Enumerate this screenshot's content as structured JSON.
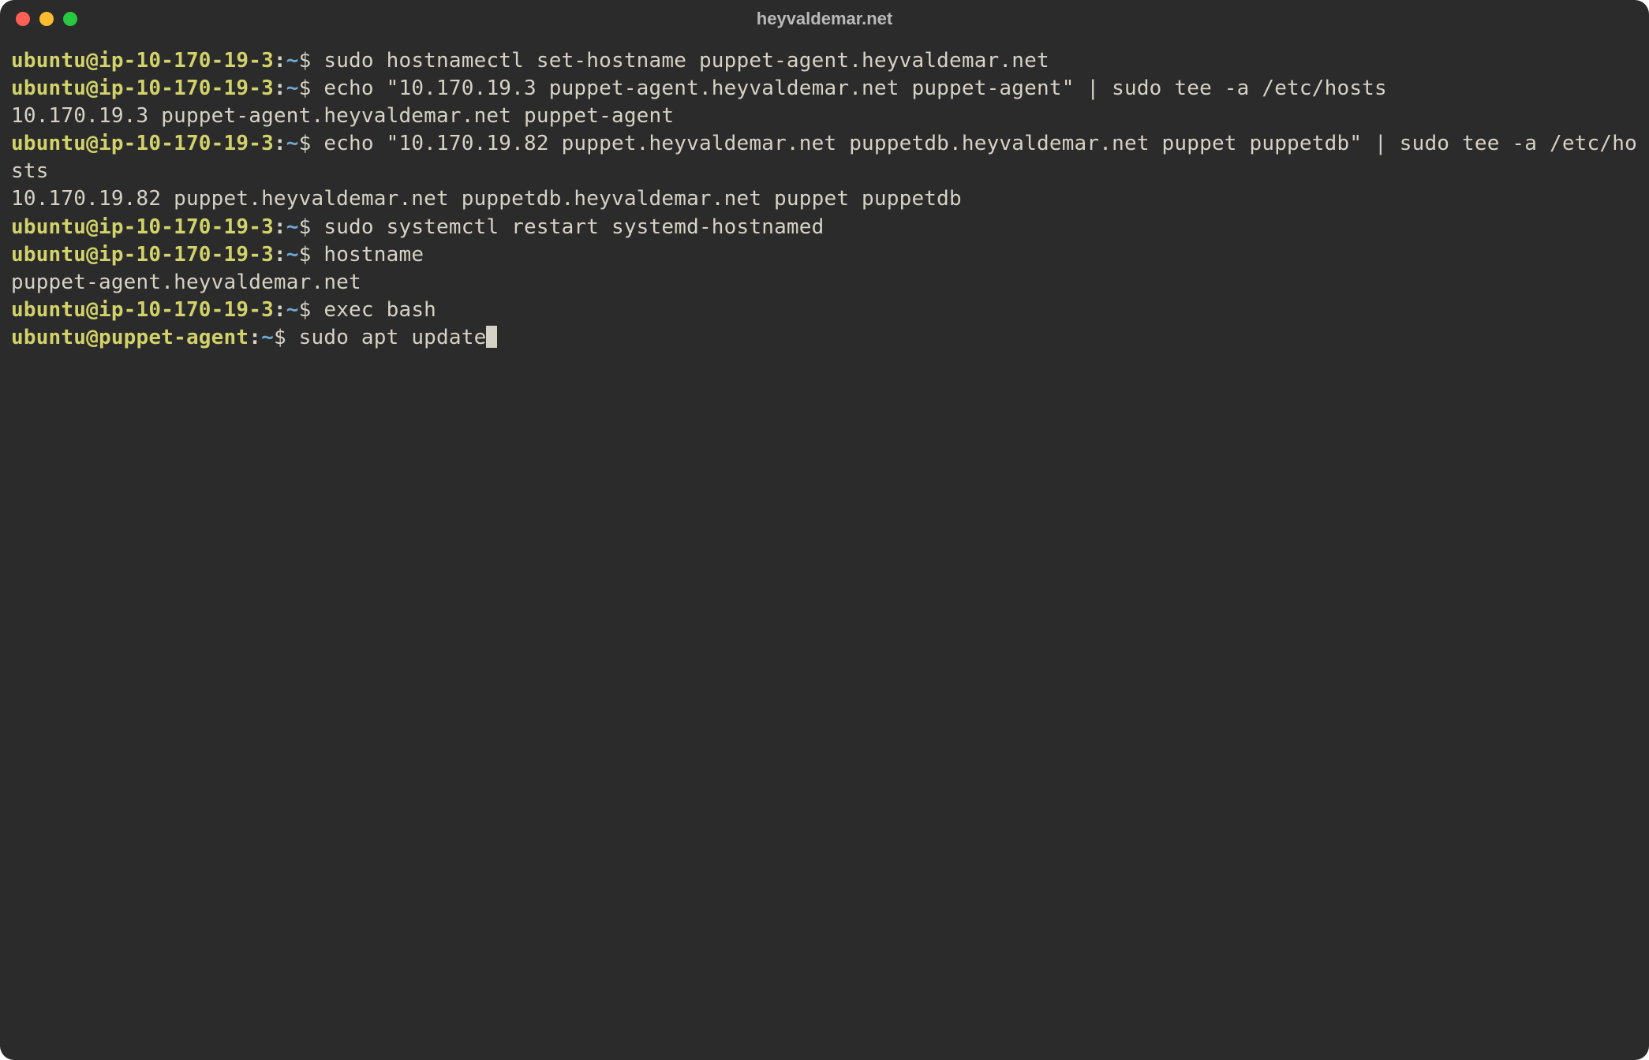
{
  "window": {
    "title": "heyvaldemar.net"
  },
  "prompts": {
    "p1": {
      "userhost": "ubuntu@ip-10-170-19-3",
      "colon": ":",
      "path": "~",
      "dollar": "$"
    },
    "p2": {
      "userhost": "ubuntu@puppet-agent",
      "colon": ":",
      "path": "~",
      "dollar": "$"
    }
  },
  "lines": {
    "cmd1": " sudo hostnamectl set-hostname puppet-agent.heyvaldemar.net",
    "cmd2": " echo \"10.170.19.3 puppet-agent.heyvaldemar.net puppet-agent\" | sudo tee -a /etc/hosts",
    "out2": "10.170.19.3 puppet-agent.heyvaldemar.net puppet-agent",
    "cmd3": " echo \"10.170.19.82 puppet.heyvaldemar.net puppetdb.heyvaldemar.net puppet puppetdb\" | sudo tee -a /etc/hosts",
    "out3": "10.170.19.82 puppet.heyvaldemar.net puppetdb.heyvaldemar.net puppet puppetdb",
    "cmd4": " sudo systemctl restart systemd-hostnamed",
    "cmd5": " hostname",
    "out5": "puppet-agent.heyvaldemar.net",
    "cmd6": " exec bash",
    "cmd7": " sudo apt update"
  }
}
